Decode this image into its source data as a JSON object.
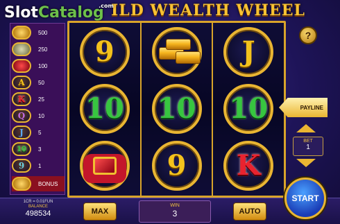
{
  "header": {
    "game_title": "ILD WEALTH WHEEL",
    "watermark_part1": "Slot",
    "watermark_part2": "Catalog",
    "watermark_suffix": ".com"
  },
  "paytable": [
    {
      "symbol": "gold-coins",
      "payout": "500"
    },
    {
      "symbol": "cash-stack",
      "payout": "250"
    },
    {
      "symbol": "ruby-ring",
      "payout": "100"
    },
    {
      "symbol": "A",
      "payout": "50"
    },
    {
      "symbol": "K",
      "payout": "25"
    },
    {
      "symbol": "Q",
      "payout": "10"
    },
    {
      "symbol": "J",
      "payout": "5"
    },
    {
      "symbol": "10",
      "payout": "3"
    },
    {
      "symbol": "9",
      "payout": "1"
    },
    {
      "symbol": "bonus",
      "payout": "BONUS"
    }
  ],
  "reels": [
    [
      "9",
      "10",
      "ring"
    ],
    [
      "gold-bars",
      "10",
      "9"
    ],
    [
      "J",
      "10",
      "K"
    ]
  ],
  "side_panel": {
    "help_label": "?",
    "payline_label": "PAYLINE",
    "bet_label": "BET",
    "bet_value": "1"
  },
  "bottom": {
    "rate": "1CR = 0.01FUN",
    "balance_label": "BALANCE",
    "balance_value": "498534",
    "max_label": "MAX",
    "win_label": "WIN",
    "win_value": "3",
    "auto_label": "AUTO",
    "start_label": "START"
  },
  "colors": {
    "gold": "#e9b532",
    "ten_green": "#37c640",
    "king_red": "#e8232f"
  }
}
